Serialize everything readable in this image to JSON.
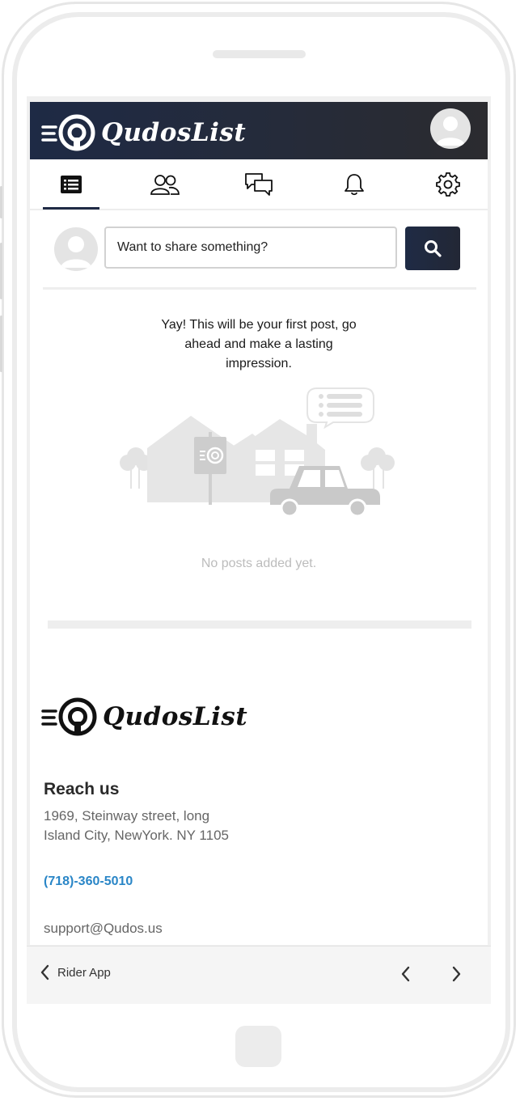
{
  "brand": {
    "name": "QudosList",
    "accent": "#1f2b45",
    "link_color": "#2a86c7"
  },
  "tabs": [
    {
      "name": "feed",
      "icon": "list-icon",
      "active": true
    },
    {
      "name": "friends",
      "icon": "users-icon",
      "active": false
    },
    {
      "name": "messages",
      "icon": "chat-icon",
      "active": false
    },
    {
      "name": "notifications",
      "icon": "bell-icon",
      "active": false
    },
    {
      "name": "settings",
      "icon": "gear-icon",
      "active": false
    }
  ],
  "composer": {
    "placeholder": "Want to share something?"
  },
  "feed": {
    "intro": "Yay! This will be your first post, go ahead and make a lasting impression.",
    "empty_text": "No posts added yet."
  },
  "footer": {
    "reach_title": "Reach us",
    "address_line1": "1969, Steinway street, long",
    "address_line2": "Island City, NewYork. NY 1105",
    "phone": "(718)-360-5010",
    "email": "support@Qudos.us"
  },
  "browser_nav": {
    "back_label": "Rider App"
  }
}
